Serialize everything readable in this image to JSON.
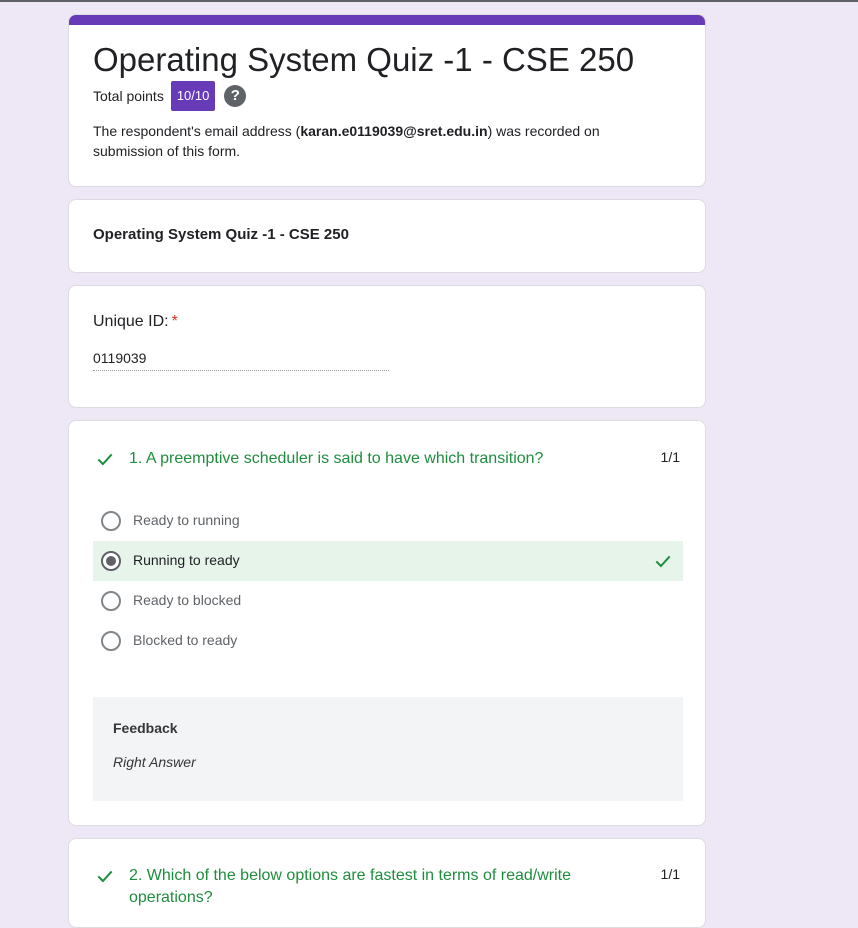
{
  "header": {
    "title": "Operating System Quiz -1 - CSE 250",
    "total_points_label": "Total points",
    "score": "10/10",
    "help_symbol": "?",
    "email_note_before": "The respondent's email address (",
    "email": "karan.e0119039@sret.edu.in",
    "email_note_after": ") was recorded on submission of this form."
  },
  "section": {
    "title": "Operating System Quiz -1 - CSE 250"
  },
  "unique_id": {
    "label": "Unique ID:",
    "required_mark": "*",
    "value": "0119039"
  },
  "questions": [
    {
      "text": "1. A preemptive scheduler is said to have which transition?",
      "score": "1/1",
      "status": "correct",
      "options": [
        {
          "label": "Ready to running",
          "selected": false
        },
        {
          "label": "Running to ready",
          "selected": true,
          "correct": true
        },
        {
          "label": "Ready to blocked",
          "selected": false
        },
        {
          "label": "Blocked to ready",
          "selected": false
        }
      ],
      "feedback": {
        "title": "Feedback",
        "text": "Right Answer"
      }
    },
    {
      "text": "2. Which of the below options are fastest in terms of read/write operations?",
      "score": "1/1",
      "status": "correct"
    }
  ],
  "colors": {
    "accent": "#673ab7",
    "background": "#ede7f6",
    "correct_green": "#1e8e3e",
    "correct_bg": "#e6f4ea"
  },
  "icons": {
    "correct_mark": "check-icon",
    "help": "help-icon"
  }
}
